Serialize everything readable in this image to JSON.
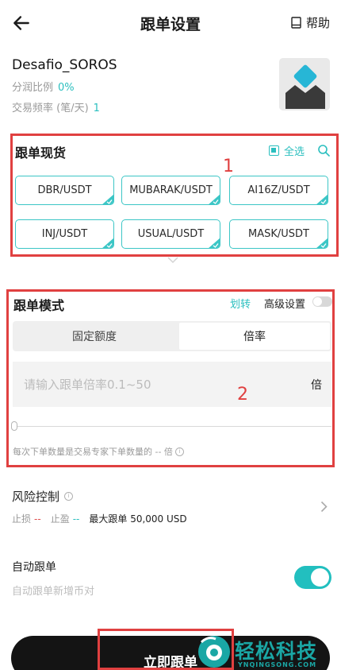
{
  "header": {
    "title": "跟单设置",
    "help_label": "帮助"
  },
  "trader": {
    "name": "Desafio_SOROS",
    "profit_share_label": "分润比例",
    "profit_share_value": "0%",
    "frequency_label": "交易频率 (笔/天)",
    "frequency_value": "1"
  },
  "spot": {
    "title": "跟单现货",
    "select_all_label": "全选",
    "annotation": "1",
    "pairs": [
      "DBR/USDT",
      "MUBARAK/USDT",
      "AI16Z/USDT",
      "INJ/USDT",
      "USUAL/USDT",
      "MASK/USDT"
    ]
  },
  "mode": {
    "title": "跟单模式",
    "transfer_label": "划转",
    "advanced_label": "高级设置",
    "tabs": [
      "固定额度",
      "倍率"
    ],
    "selected_tab": "倍率",
    "input_placeholder": "请输入跟单倍率0.1~50",
    "unit": "倍",
    "annotation": "2",
    "hint": "每次下单数量是交易专家下单数量的 -- 倍"
  },
  "risk": {
    "title": "风险控制",
    "stop_loss_label": "止损",
    "stop_loss_value": "--",
    "take_profit_label": "止盈",
    "take_profit_value": "--",
    "max_follow": "最大跟单 50,000 USD"
  },
  "auto_follow": {
    "title": "自动跟单",
    "subtitle": "自动跟单新增币对",
    "enabled": true
  },
  "cta": {
    "label": "立即跟单"
  },
  "watermark": {
    "text": "轻松科技",
    "sub": "YNQINGSONG.COM"
  },
  "colors": {
    "accent": "#2bbfbf",
    "annotation_red": "#e04040",
    "button_dark": "#141414"
  }
}
